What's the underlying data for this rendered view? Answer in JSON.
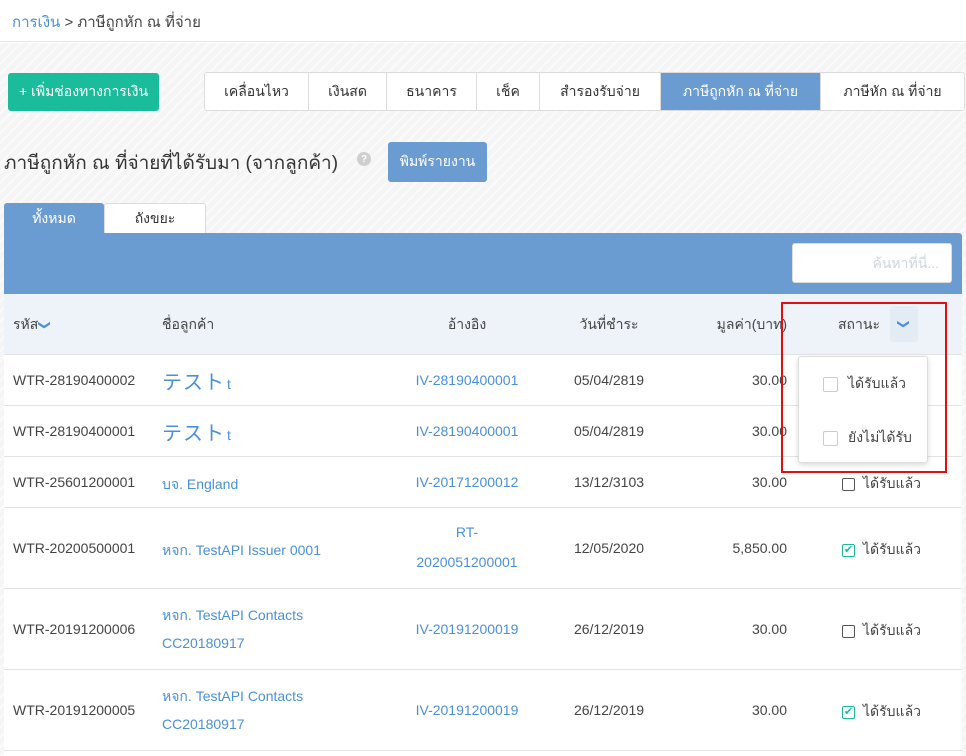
{
  "breadcrumb": {
    "parent": "การเงิน",
    "separator": " > ",
    "current": "ภาษีถูกหัก ณ ที่จ่าย"
  },
  "toolbar": {
    "add_label": "+ เพิ่มช่องทางการเงิน"
  },
  "tabs": [
    {
      "label": "เคลื่อนไหว",
      "active": false
    },
    {
      "label": "เงินสด",
      "active": false
    },
    {
      "label": "ธนาคาร",
      "active": false
    },
    {
      "label": "เช็ค",
      "active": false
    },
    {
      "label": "สำรองรับจ่าย",
      "active": false
    },
    {
      "label": "ภาษีถูกหัก ณ ที่จ่าย",
      "active": true
    },
    {
      "label": "ภาษีหัก ณ ที่จ่าย",
      "active": false
    }
  ],
  "page": {
    "title": "ภาษีถูกหัก ณ ที่จ่ายที่ได้รับมา (จากลูกค้า)",
    "help_icon": "?",
    "print_label": "พิมพ์รายงาน"
  },
  "sub_tabs": {
    "all": "ทั้งหมด",
    "trash": "ถังขยะ"
  },
  "search": {
    "placeholder": "ค้นหาที่นี่..."
  },
  "table": {
    "headers": {
      "code": "รหัส",
      "customer": "ชื่อลูกค้า",
      "reference": "อ้างอิง",
      "date": "วันที่ชำระ",
      "amount": "มูลค่า(บาท)",
      "status": "สถานะ"
    },
    "rows": [
      {
        "code": "WTR-28190400002",
        "customer": "テスト",
        "customer_suffix": "t",
        "ref": "IV-28190400001",
        "ref2": "",
        "date": "05/04/2819",
        "amount": "30.00",
        "status": "",
        "checked": false
      },
      {
        "code": "WTR-28190400001",
        "customer": "テスト",
        "customer_suffix": "t",
        "ref": "IV-28190400001",
        "ref2": "",
        "date": "05/04/2819",
        "amount": "30.00",
        "status": "",
        "checked": false
      },
      {
        "code": "WTR-25601200001",
        "customer": "บจ. England",
        "customer2": "",
        "ref": "IV-20171200012",
        "ref2": "",
        "date": "13/12/3103",
        "amount": "30.00",
        "status": "ได้รับแล้ว",
        "checked": false
      },
      {
        "code": "WTR-20200500001",
        "customer": "หจก. TestAPI Issuer 0001",
        "customer2": "",
        "ref": "RT-",
        "ref2": "2020051200001",
        "date": "12/05/2020",
        "amount": "5,850.00",
        "status": "ได้รับแล้ว",
        "checked": true
      },
      {
        "code": "WTR-20191200006",
        "customer": "หจก. TestAPI Contacts",
        "customer2": "CC20180917",
        "ref": "IV-20191200019",
        "ref2": "",
        "date": "26/12/2019",
        "amount": "30.00",
        "status": "ได้รับแล้ว",
        "checked": false
      },
      {
        "code": "WTR-20191200005",
        "customer": "หจก. TestAPI Contacts",
        "customer2": "CC20180917",
        "ref": "IV-20191200019",
        "ref2": "",
        "date": "26/12/2019",
        "amount": "30.00",
        "status": "ได้รับแล้ว",
        "checked": true
      }
    ]
  },
  "status_filter": {
    "received": "ได้รับแล้ว",
    "not_received": "ยังไม่ได้รับ"
  },
  "icons": {
    "sort": "chevron-down-icon",
    "check": "✔"
  },
  "colors": {
    "accent": "#6a9bd1",
    "primary_green": "#1abc9c",
    "link": "#4a90d9",
    "highlight": "#e01010"
  }
}
